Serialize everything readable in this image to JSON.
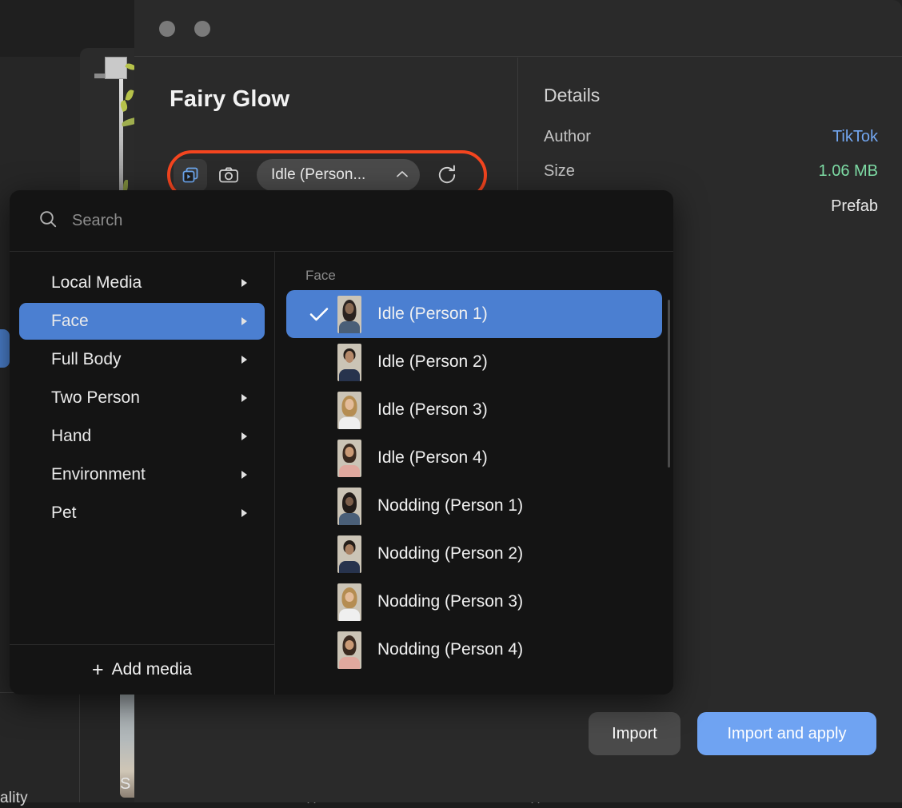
{
  "background": {
    "quality_text": "ality",
    "thumb_label": "S",
    "x_marks": [
      "✕",
      "✕"
    ]
  },
  "window": {
    "traffic_lights": [
      "close-button",
      "minimize-button"
    ]
  },
  "asset": {
    "title": "Fairy Glow"
  },
  "toolbar": {
    "media_icon": "video-stack-icon",
    "camera_icon": "camera-icon",
    "dropdown_label": "Idle (Person...",
    "dropdown_caret": "chevron-up-icon",
    "refresh_icon": "refresh-icon"
  },
  "details": {
    "title": "Details",
    "rows": [
      {
        "key": "Author",
        "value": "TikTok",
        "style": "link"
      },
      {
        "key": "Size",
        "value": "1.06 MB",
        "style": "size"
      },
      {
        "key": "",
        "value": "Prefab",
        "style": "plain"
      }
    ]
  },
  "footer": {
    "import_label": "Import",
    "import_apply_label": "Import and apply"
  },
  "popover": {
    "search": {
      "icon": "search-icon",
      "placeholder": "Search",
      "value": ""
    },
    "categories": [
      {
        "label": "Local Media",
        "selected": false
      },
      {
        "label": "Face",
        "selected": true
      },
      {
        "label": "Full Body",
        "selected": false
      },
      {
        "label": "Two Person",
        "selected": false
      },
      {
        "label": "Hand",
        "selected": false
      },
      {
        "label": "Environment",
        "selected": false
      },
      {
        "label": "Pet",
        "selected": false
      }
    ],
    "add_media_label": "Add media",
    "add_media_plus": "+",
    "list_header": "Face",
    "items": [
      {
        "label": "Idle (Person 1)",
        "selected": true
      },
      {
        "label": "Idle (Person 2)",
        "selected": false
      },
      {
        "label": "Idle (Person 3)",
        "selected": false
      },
      {
        "label": "Idle (Person 4)",
        "selected": false
      },
      {
        "label": "Nodding (Person 1)",
        "selected": false
      },
      {
        "label": "Nodding (Person 2)",
        "selected": false
      },
      {
        "label": "Nodding (Person 3)",
        "selected": false
      },
      {
        "label": "Nodding (Person 4)",
        "selected": false
      }
    ]
  },
  "colors": {
    "accent_blue": "#4b7fd1",
    "primary_button": "#6fa3f2",
    "highlight_ring": "#f4451f",
    "link": "#72a6f0",
    "size_green": "#7ddba4",
    "window_bg": "#2a2a2a",
    "popover_bg": "#141414"
  }
}
